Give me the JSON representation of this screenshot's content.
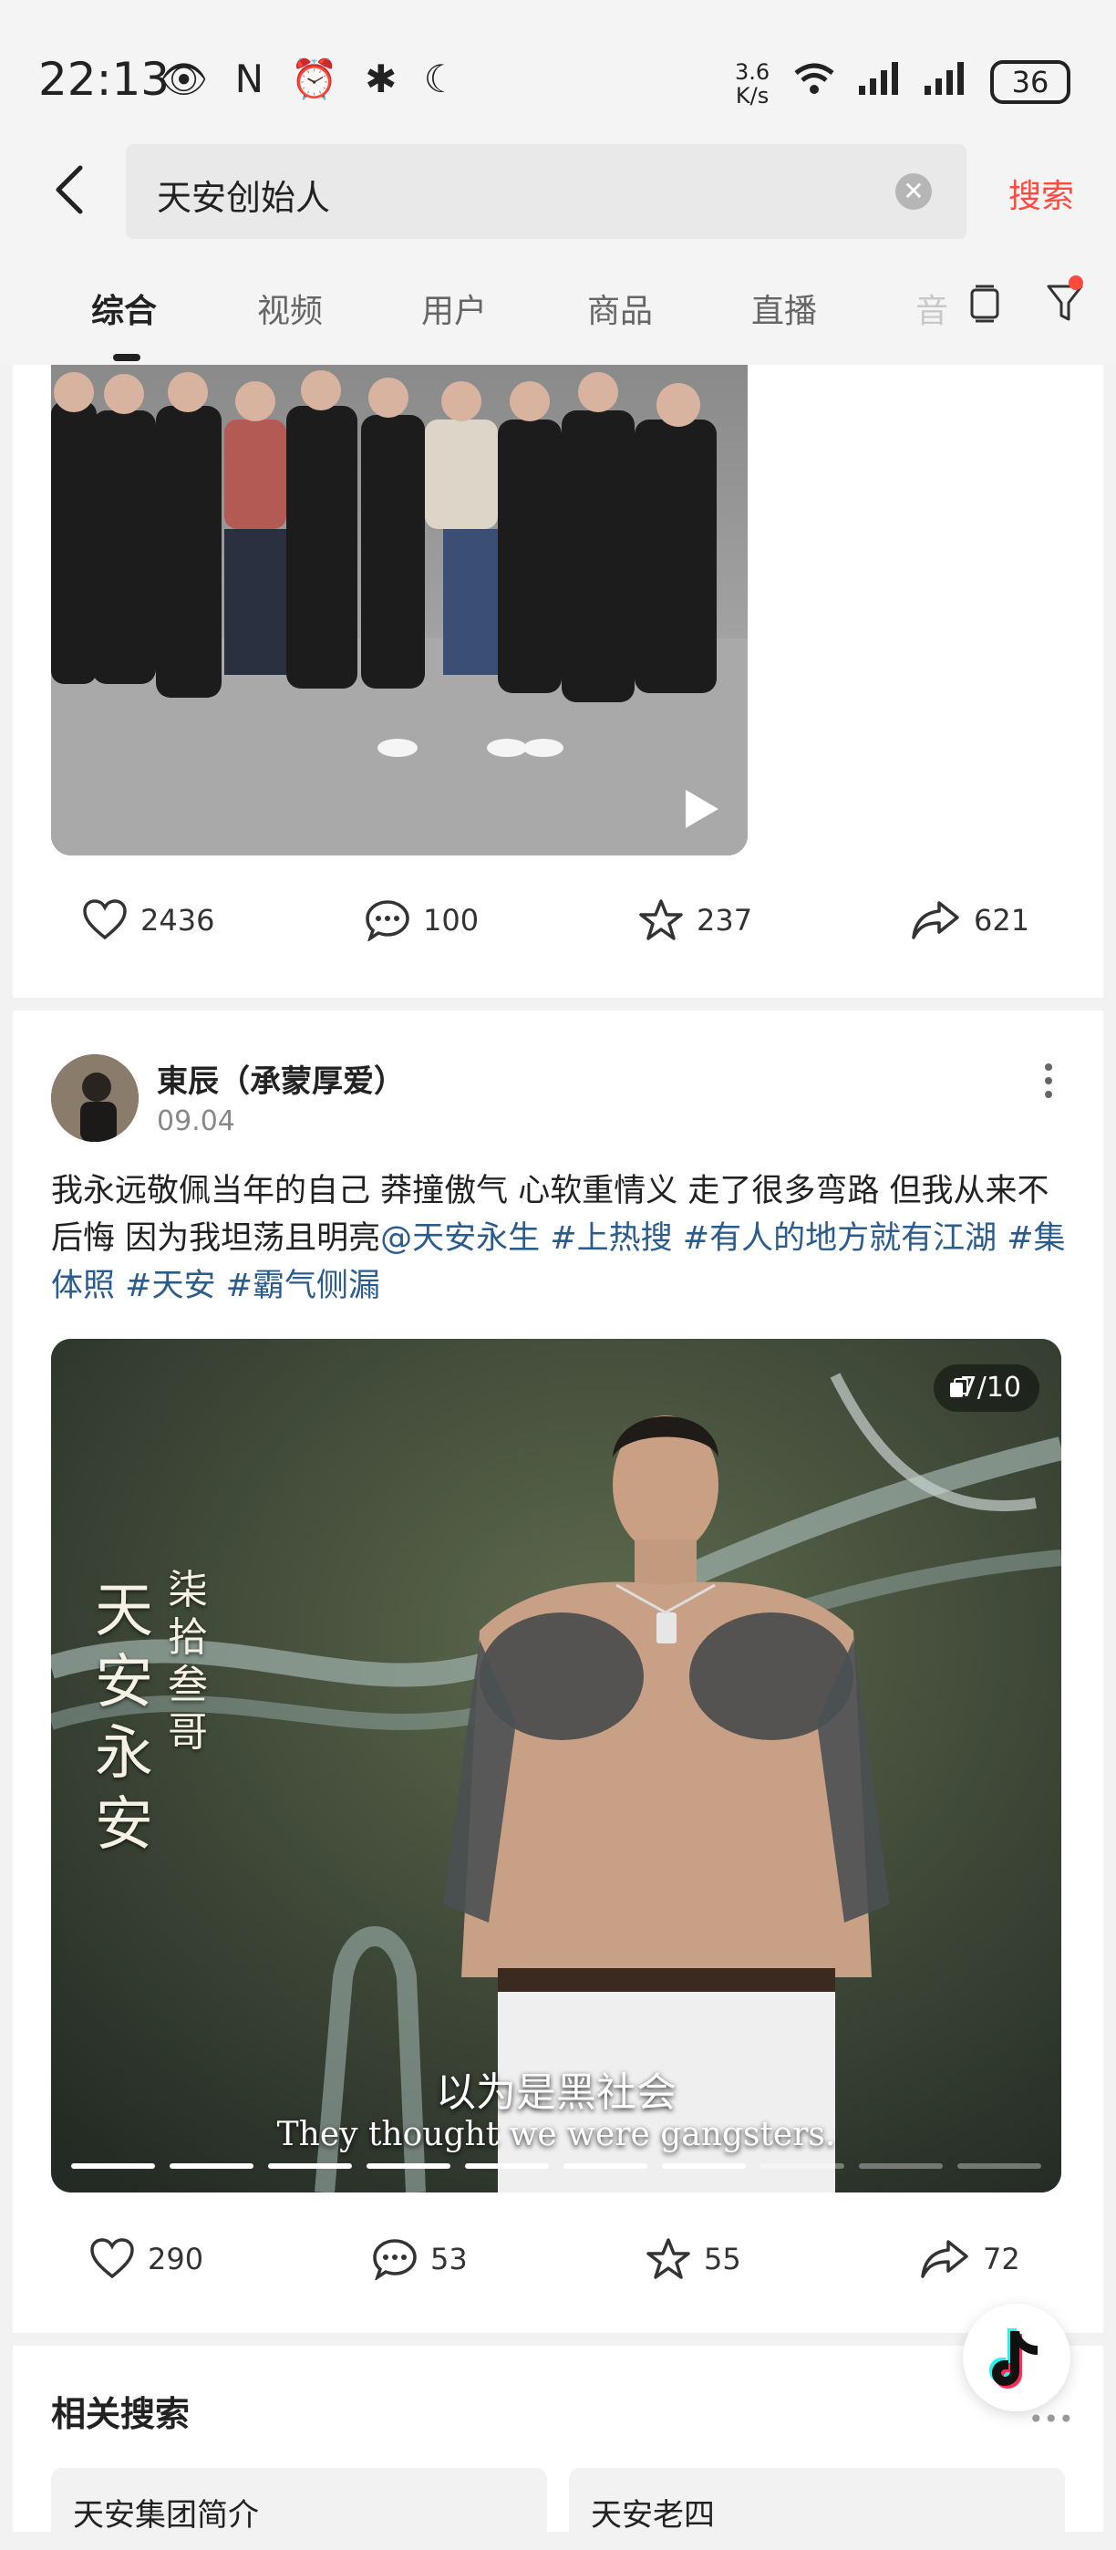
{
  "status_bar": {
    "time": "22:13",
    "left_icons": "👁 N ⏰ ✱ ☾",
    "speed_value": "3.6",
    "speed_unit": "K/s",
    "battery": "36"
  },
  "search": {
    "query": "天安创始人",
    "search_button": "搜索"
  },
  "tabs": [
    {
      "label": "综合",
      "active": true
    },
    {
      "label": "视频"
    },
    {
      "label": "用户"
    },
    {
      "label": "商品"
    },
    {
      "label": "直播"
    },
    {
      "label": "音"
    }
  ],
  "post1": {
    "likes": "2436",
    "comments": "100",
    "favorites": "237",
    "shares": "621"
  },
  "post2": {
    "author": "東辰（承蒙厚爱）",
    "date": "09.04",
    "text_part1": "我永远敬佩当年的自己 莽撞傲气 心软重情义 走了很多弯路 但我从来不后悔 因为我坦荡且明亮",
    "mention": "@天安永生",
    "tags": [
      "#上热搜",
      "#有人的地方就有江湖",
      "#集体照",
      "#天安",
      "#霸气侧漏"
    ],
    "page_indicator": "7/10",
    "calligraphy_main": "天安永安",
    "calligraphy_side": "柒拾叁哥",
    "subtitle_cn": "以为是黑社会",
    "subtitle_en": "They thought we were gangsters.",
    "current_page": 7,
    "total_pages": 10,
    "likes": "290",
    "comments": "53",
    "favorites": "55",
    "shares": "72"
  },
  "related": {
    "title": "相关搜索",
    "items": [
      "天安集团简介",
      "天安老四"
    ]
  },
  "colors": {
    "accent": "#ff4b3e",
    "tag_blue": "#2a5c8d"
  }
}
